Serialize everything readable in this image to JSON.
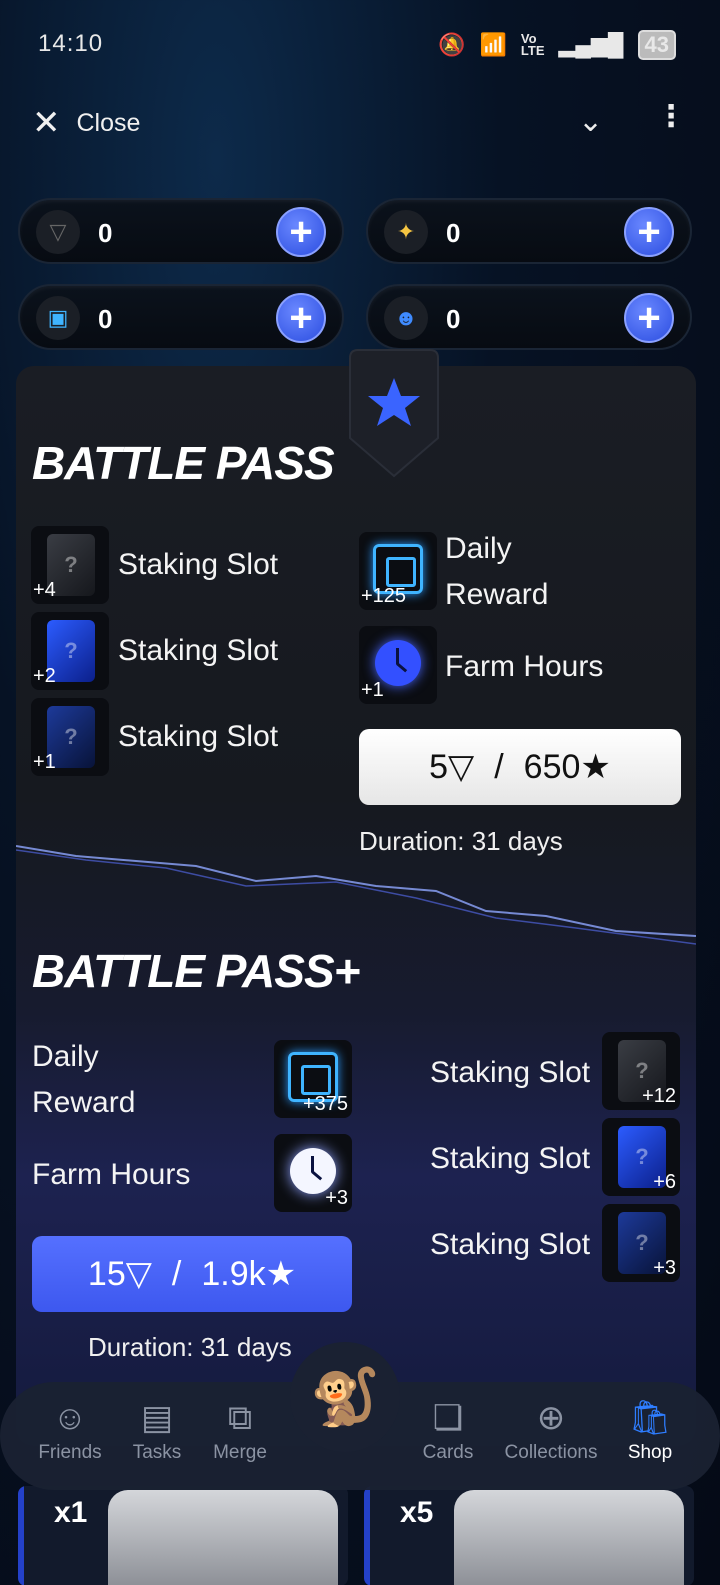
{
  "status": {
    "time": "14:10",
    "battery": "43"
  },
  "topbar": {
    "close_label": "Close"
  },
  "currencies": [
    {
      "icon": "ton-icon",
      "value": "0"
    },
    {
      "icon": "stars-icon",
      "value": "0"
    },
    {
      "icon": "chip-icon",
      "value": "0"
    },
    {
      "icon": "gorilla-icon",
      "value": "0"
    }
  ],
  "battle_pass": {
    "title": "BATTLE PASS",
    "left_rewards": [
      {
        "label": "Staking Slot",
        "qty": "+4",
        "icon": "grey-card-pack-icon"
      },
      {
        "label": "Staking Slot",
        "qty": "+2",
        "icon": "blue-card-pack-icon"
      },
      {
        "label": "Staking Slot",
        "qty": "+1",
        "icon": "dark-blue-card-pack-icon"
      }
    ],
    "right_rewards": [
      {
        "label_line1": "Daily",
        "label_line2": "Reward",
        "qty": "+125",
        "icon": "chip-icon"
      },
      {
        "label": "Farm Hours",
        "qty": "+1",
        "icon": "clock-icon"
      }
    ],
    "price_ton": "5",
    "price_separator": "/",
    "price_stars": "650",
    "duration": "Duration: 31 days"
  },
  "battle_pass_plus": {
    "title": "BATTLE PASS+",
    "left_rewards": [
      {
        "label_line1": "Daily",
        "label_line2": "Reward",
        "qty": "+375",
        "icon": "chip-icon"
      },
      {
        "label": "Farm Hours",
        "qty": "+3",
        "icon": "clock-icon"
      }
    ],
    "right_rewards": [
      {
        "label": "Staking Slot",
        "qty": "+12",
        "icon": "grey-card-pack-icon"
      },
      {
        "label": "Staking Slot",
        "qty": "+6",
        "icon": "blue-card-pack-icon"
      },
      {
        "label": "Staking Slot",
        "qty": "+3",
        "icon": "dark-blue-card-pack-icon"
      }
    ],
    "price_ton": "15",
    "price_separator": "/",
    "price_stars": "1.9k",
    "duration": "Duration: 31 days"
  },
  "nav": {
    "items": [
      {
        "label": "Friends",
        "icon": "astronaut-icon"
      },
      {
        "label": "Tasks",
        "icon": "clipboard-icon"
      },
      {
        "label": "Merge",
        "icon": "merge-icon"
      },
      {
        "label": "Cards",
        "icon": "cards-icon"
      },
      {
        "label": "Collections",
        "icon": "plus-circle-icon"
      },
      {
        "label": "Shop",
        "icon": "shopping-bag-icon"
      }
    ],
    "active": "Shop"
  },
  "packs": [
    {
      "multiplier": "x1"
    },
    {
      "multiplier": "x5"
    }
  ],
  "colors": {
    "accent_blue": "#3d58ef",
    "active_nav": "#2e7dff",
    "panel_bg": "#16191f"
  }
}
